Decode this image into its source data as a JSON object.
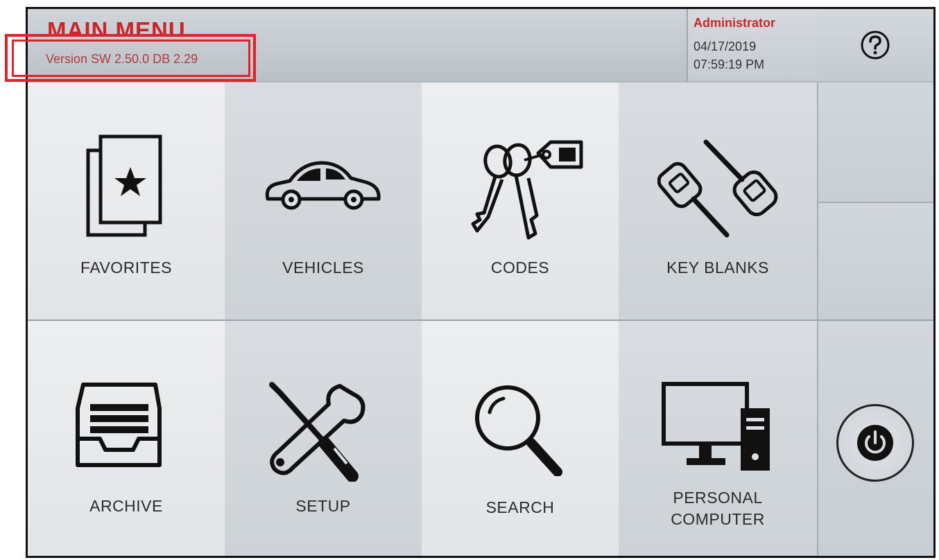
{
  "header": {
    "title": "MAIN MENU",
    "version": "Version SW 2.50.0 DB 2.29",
    "user": "Administrator",
    "date": "04/17/2019",
    "time": "07:59:19 PM",
    "help_icon": "question-mark-icon"
  },
  "menu": {
    "favorites": "FAVORITES",
    "vehicles": "VEHICLES",
    "codes": "CODES",
    "key_blanks": "KEY BLANKS",
    "archive": "ARCHIVE",
    "setup": "SETUP",
    "search": "SEARCH",
    "personal_computer_line1": "PERSONAL",
    "personal_computer_line2": "COMPUTER"
  },
  "sidebar": {
    "power_icon": "power-icon"
  },
  "colors": {
    "accent": "#c8272a",
    "highlight": "#e0222a"
  }
}
